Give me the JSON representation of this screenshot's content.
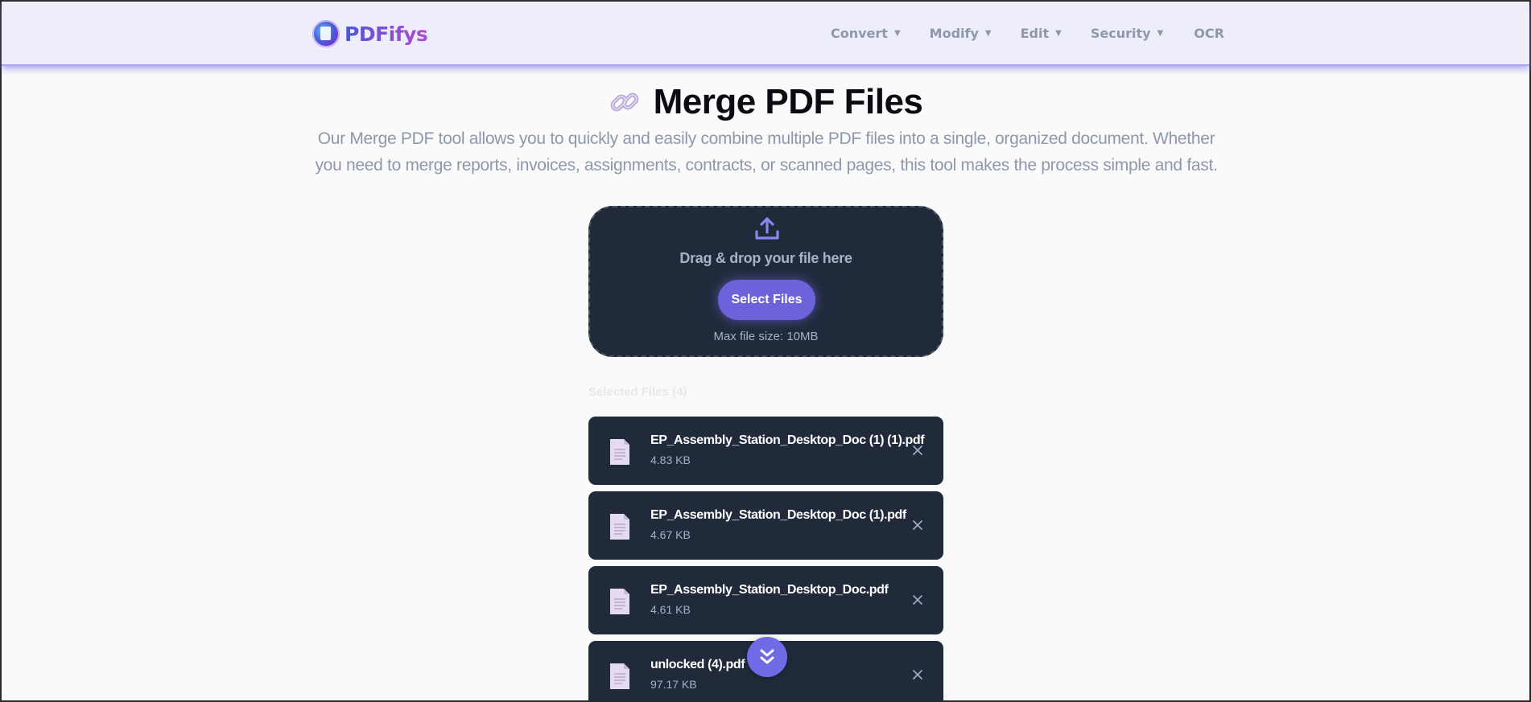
{
  "brand": {
    "name": "PDFifys"
  },
  "nav": {
    "items": [
      {
        "label": "Convert",
        "caret": "▼"
      },
      {
        "label": "Modify",
        "caret": "▼"
      },
      {
        "label": "Edit",
        "caret": "▼"
      },
      {
        "label": "Security",
        "caret": "▼"
      },
      {
        "label": "OCR"
      }
    ]
  },
  "page": {
    "title": "Merge PDF Files",
    "icon": "link-icon",
    "description": "Our Merge PDF tool allows you to quickly and easily combine multiple PDF files into a single, organized document. Whether you need to merge reports, invoices, assignments, contracts, or scanned pages, this tool makes the process simple and fast."
  },
  "upload": {
    "icon": "upload-icon",
    "drag_text": "Drag & drop your file here",
    "button_label": "Select Files",
    "max_size": "Max file size: 10MB"
  },
  "selected": {
    "heading": "Selected Files (4)",
    "files": [
      {
        "name": "EP_Assembly_Station_Desktop_Doc (1) (1).pdf",
        "size": "4.83 KB"
      },
      {
        "name": "EP_Assembly_Station_Desktop_Doc (1).pdf",
        "size": "4.67 KB"
      },
      {
        "name": "EP_Assembly_Station_Desktop_Doc.pdf",
        "size": "4.61 KB"
      },
      {
        "name": "unlocked (4).pdf",
        "size": "97.17 KB"
      }
    ]
  },
  "colors": {
    "accent": "#6c63db",
    "card": "#212a3b",
    "muted_text": "#8e98ac",
    "nav_bg": "#eeeefa"
  }
}
